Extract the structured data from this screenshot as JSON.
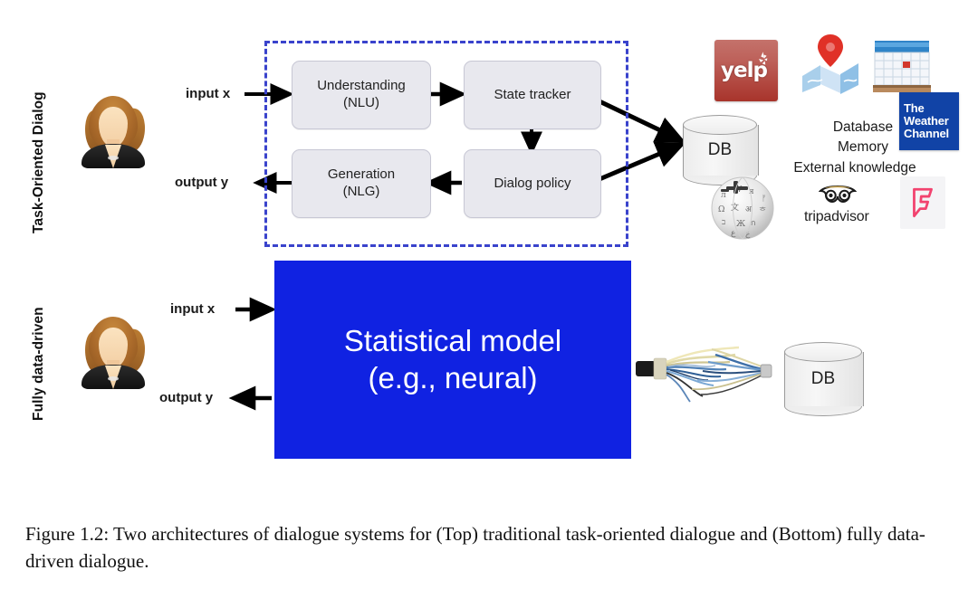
{
  "figure": {
    "caption": "Figure 1.2:  Two architectures of dialogue systems for (Top) traditional task-oriented dialogue and (Bottom) fully data-driven dialogue."
  },
  "top_section": {
    "side_label": "Task-Oriented Dialog",
    "avatar_name": "user-avatar",
    "input_label": "input x",
    "output_label": "output y",
    "modules": [
      {
        "id": "nlu",
        "line1": "Understanding",
        "line2": "(NLU)"
      },
      {
        "id": "state_tracker",
        "line1": "State tracker",
        "line2": ""
      },
      {
        "id": "nlg",
        "line1": "Generation",
        "line2": "(NLG)"
      },
      {
        "id": "dialog_policy",
        "line1": "Dialog policy",
        "line2": ""
      }
    ],
    "db_label": "DB",
    "knowledge_sources": {
      "line1": "Database",
      "line2": "Memory",
      "line3": "External knowledge"
    },
    "logos": {
      "yelp": "yelp",
      "maps": "map-pin-icon",
      "calendar": "calendar-icon",
      "weather_channel_line1": "The",
      "weather_channel_line2": "Weather",
      "weather_channel_line3": "Channel",
      "wikipedia": "wikipedia-globe-icon",
      "tripadvisor": "tripadvisor",
      "foursquare": "foursquare-icon"
    }
  },
  "bottom_section": {
    "side_label": "Fully data-driven",
    "avatar_name": "user-avatar",
    "input_label": "input x",
    "output_label": "output y",
    "model_line1": "Statistical model",
    "model_line2": "(e.g., neural)",
    "db_label": "DB",
    "cable_name": "network-cable-icon"
  },
  "colors": {
    "dashed_border": "#3a43cc",
    "model_box": "#1022e2",
    "module_fill": "#e8e8ee",
    "yelp_red": "#a8342b",
    "weather_blue": "#1143a6",
    "foursquare_pink": "#f2436f"
  }
}
